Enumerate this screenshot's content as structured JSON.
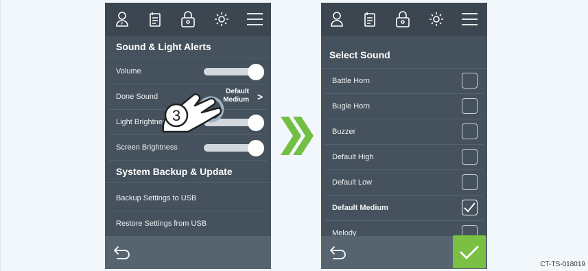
{
  "left_screen": {
    "top_icons": [
      "user-icon",
      "notes-icon",
      "lock-icon",
      "brightness-icon",
      "menu-icon"
    ],
    "sound_light_header": "Sound & Light Alerts",
    "volume_label": "Volume",
    "done_sound_label": "Done Sound",
    "done_sound_value_line1": "Default",
    "done_sound_value_line2": "Medium",
    "light_brightness_label": "Light Brightness",
    "screen_brightness_label": "Screen Brightness",
    "system_header": "System Backup & Update",
    "backup_label": "Backup Settings to USB",
    "restore_label": "Restore Settings from USB",
    "back_icon": "back-arrow-icon",
    "step_number": "3"
  },
  "right_screen": {
    "title": "Select Sound",
    "options": [
      {
        "label": "Battle Horn",
        "checked": false
      },
      {
        "label": "Bugle Horn",
        "checked": false
      },
      {
        "label": "Buzzer",
        "checked": false
      },
      {
        "label": "Default High",
        "checked": false
      },
      {
        "label": "Default Low",
        "checked": false
      },
      {
        "label": "Default Medium",
        "checked": true
      },
      {
        "label": "Melody",
        "checked": false
      }
    ],
    "back_icon": "back-arrow-icon",
    "confirm_icon": "checkmark-icon"
  },
  "caption": "CT-TS-018019",
  "colors": {
    "screen_bg": "#45525d",
    "topbar_bg": "#3b4650",
    "bottombar_bg": "#566470",
    "accent_green": "#79c043"
  }
}
